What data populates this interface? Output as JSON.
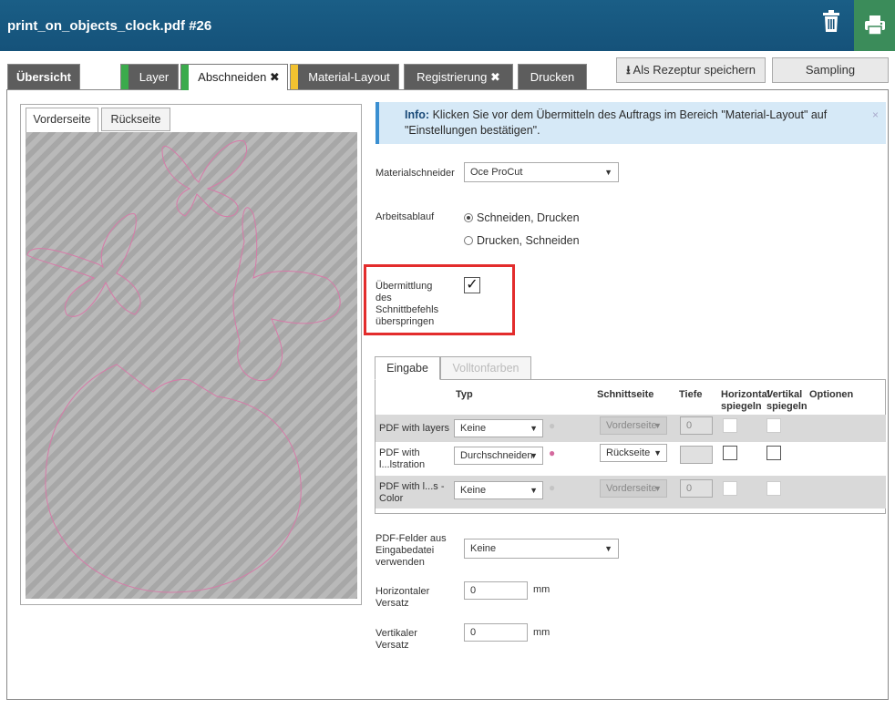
{
  "window": {
    "title": "print_on_objects_clock.pdf #26"
  },
  "header_icons": {
    "trash": "trash-icon",
    "print": "printer-icon"
  },
  "tabs": [
    {
      "label": "Übersicht",
      "stripe": ""
    },
    {
      "label": "Layer",
      "stripe": "#3bab4c"
    },
    {
      "label": "Abschneiden ✖",
      "stripe": "#3bab4c"
    },
    {
      "label": "Material-Layout",
      "stripe": "#f2c230"
    },
    {
      "label": "Registrierung ✖",
      "stripe": ""
    },
    {
      "label": "Drucken",
      "stripe": ""
    }
  ],
  "buttons": {
    "save_recipe": "Als Rezeptur speichern",
    "sampling": "Sampling"
  },
  "preview_tabs": {
    "front": "Vorderseite",
    "back": "Rückseite"
  },
  "info": {
    "title": "Info:",
    "text": "Klicken Sie vor dem Übermitteln des Auftrags im Bereich \"Material-Layout\" auf \"Einstellungen bestätigen\".",
    "close": "×"
  },
  "form": {
    "cutter_label": "Materialschneider",
    "cutter_value": "Oce ProCut",
    "workflow_label": "Arbeitsablauf",
    "workflow_opt1": "Schneiden, Drucken",
    "workflow_opt2": "Drucken, Schneiden",
    "skip_label": "Übermittlung des Schnittbefehls überspringen",
    "skip_checked": true
  },
  "table_tabs": {
    "input": "Eingabe",
    "spot": "Volltonfarben"
  },
  "table": {
    "headers": {
      "type": "Typ",
      "cut_side": "Schnittseite",
      "depth": "Tiefe",
      "mirror_h": "Horizontal spiegeln",
      "mirror_v": "Vertikal spiegeln",
      "options": "Optionen"
    },
    "rows": [
      {
        "label": "PDF with layers",
        "type": "Keine",
        "side": "Vorderseite",
        "depth": "0"
      },
      {
        "label": "PDF with l...lstration",
        "type": "Durchschneiden",
        "side": "Rückseite",
        "depth": ""
      },
      {
        "label": "PDF with l...s - Color",
        "type": "Keine",
        "side": "Vorderseite",
        "depth": "0"
      }
    ]
  },
  "fields": {
    "pdf_fields_label": "PDF-Felder aus Eingabedatei verwenden",
    "pdf_fields_value": "Keine",
    "h_offset_label": "Horizontaler Versatz",
    "h_offset_value": "0",
    "v_offset_label": "Vertikaler Versatz",
    "v_offset_value": "0",
    "unit": "mm"
  },
  "colors": {
    "accent": "#1a5e86",
    "print_button": "#3b8c5a",
    "highlight": "#e32c2c",
    "cut_line": "#d77aa8"
  }
}
